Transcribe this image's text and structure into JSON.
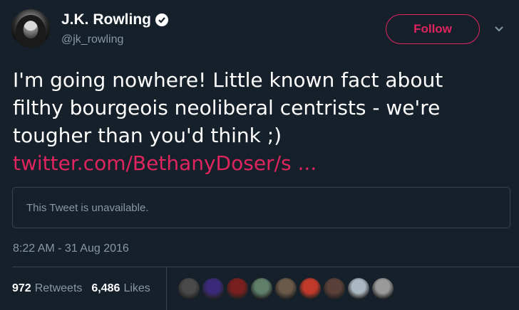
{
  "author": {
    "name": "J.K. Rowling",
    "handle": "@jk_rowling",
    "verified": true
  },
  "follow_button": {
    "label": "Follow"
  },
  "tweet": {
    "lines": [
      "I'm going nowhere! Little known fact about",
      "filthy bourgeois neoliberal centrists - we're",
      "tougher than you'd think ;)"
    ],
    "link": "twitter.com/BethanyDoser/s ...",
    "quoted_status": "This Tweet is unavailable.",
    "timestamp": "8:22 AM - 31 Aug 2016"
  },
  "stats": {
    "retweets_count": "972",
    "retweets_label": "Retweets",
    "likes_count": "6,486",
    "likes_label": "Likes"
  },
  "likers": [
    {
      "name": "liker-avatar-1",
      "color": "#4a4a4a"
    },
    {
      "name": "liker-avatar-2",
      "color": "#3a2a7a"
    },
    {
      "name": "liker-avatar-3",
      "color": "#7a1f1f"
    },
    {
      "name": "liker-avatar-4",
      "color": "#5f7f6a"
    },
    {
      "name": "liker-avatar-5",
      "color": "#6b5a4a"
    },
    {
      "name": "liker-avatar-6",
      "color": "#c0392b"
    },
    {
      "name": "liker-avatar-7",
      "color": "#5a4038"
    },
    {
      "name": "liker-avatar-8",
      "color": "#aab8c2"
    },
    {
      "name": "liker-avatar-9",
      "color": "#9a9a9a"
    }
  ],
  "colors": {
    "background": "#15202b",
    "accent": "#e0245e",
    "muted": "#8899a6",
    "border": "#38444d"
  }
}
